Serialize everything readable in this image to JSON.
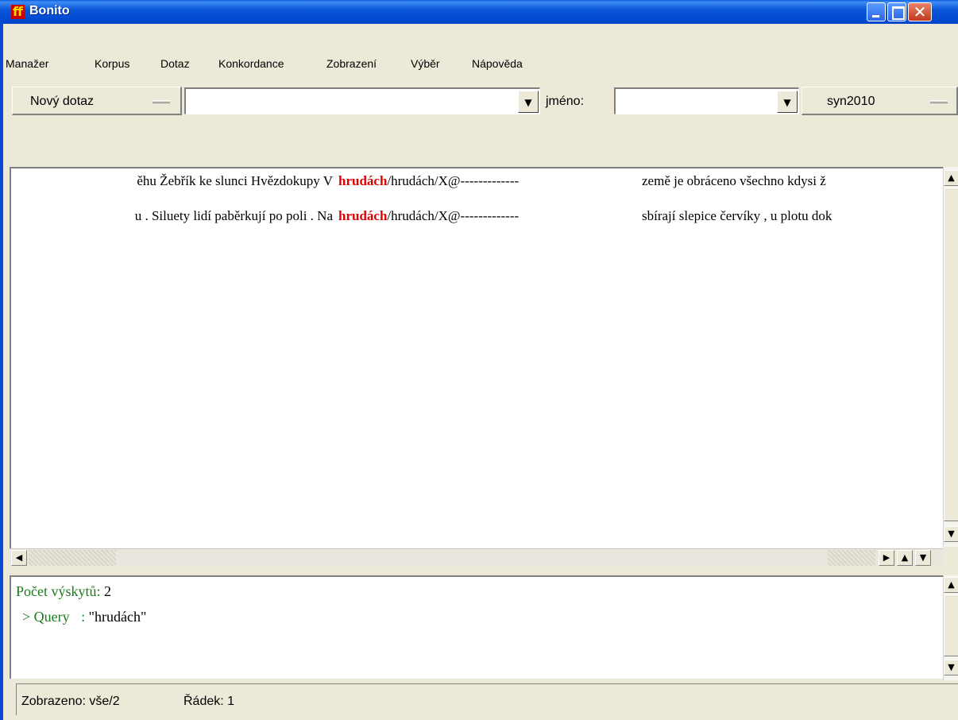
{
  "window": {
    "title": "Bonito",
    "icon_glyph": "ff",
    "close_glyph": "✕"
  },
  "menu": [
    "Manažer",
    "Korpus",
    "Dotaz",
    "Konkordance",
    "Zobrazení",
    "Výběr",
    "Nápověda"
  ],
  "toolbar": {
    "query_button": "Nový dotaz",
    "query_value": "",
    "name_label": "jméno:",
    "name_value": "",
    "corpus_button": "syn2010",
    "dropdown_arrow": "▼"
  },
  "concordance": {
    "rows": [
      {
        "left": "ěhu Žebřík ke slunci Hvězdokupy V",
        "kwic": "hrudách",
        "attrs": "/hrudách/X@-------------",
        "right": "země je obráceno všechno kdysi ž"
      },
      {
        "left": "u . Siluety lidí paběrkují po poli . Na",
        "kwic": "hrudách",
        "attrs": "/hrudách/X@-------------",
        "right": "sbírají slepice červíky , u plotu dok"
      }
    ],
    "scroll_up": "▲",
    "scroll_down": "▼",
    "scroll_left": "◀",
    "scroll_right": "▶"
  },
  "info": {
    "count_label": "Počet výskytů:",
    "count_value": "2",
    "query_label": "> Query",
    "query_sep": ":",
    "query_value": "\"hrudách\""
  },
  "status": {
    "shown": "Zobrazeno: vše/2",
    "row": "Řádek: 1"
  }
}
